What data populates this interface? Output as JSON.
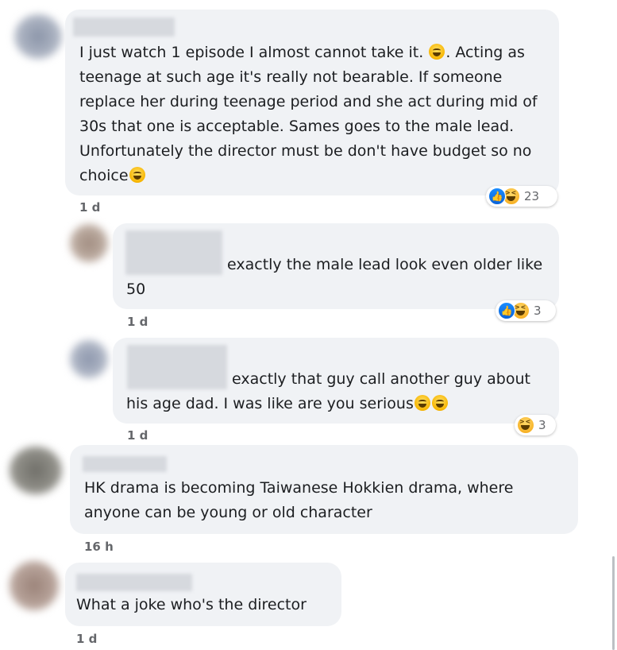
{
  "comments": [
    {
      "text_parts": [
        "I just watch 1 episode I almost cannot take it. ",
        ". Acting as teenage at such age it's really not bearable. If someone replace her during teenage period and she act during mid of 30s that one is acceptable. Sames goes to the male lead. Unfortunately the director must be don't have budget so no choice"
      ],
      "time": "1 d",
      "reaction_count": "23"
    },
    {
      "text": "exactly the male lead look even older like 50",
      "time": "1 d",
      "reaction_count": "3"
    },
    {
      "text": "exactly that guy call another guy about his age dad. I was like are you serious",
      "time": "1 d",
      "reaction_count": "3"
    },
    {
      "text": "HK drama is becoming Taiwanese Hokkien drama, where anyone can be young or old character",
      "time": "16 h"
    },
    {
      "text": "What a joke who's the director",
      "time": "1 d"
    }
  ],
  "icons": {
    "like": "thumbs-up-icon",
    "haha": "laughing-face-icon",
    "emoji": "grinning-sweat-emoji"
  },
  "colors": {
    "bubble": "#f0f2f5",
    "like_blue": "#1877f2",
    "meta_gray": "#65676b"
  }
}
